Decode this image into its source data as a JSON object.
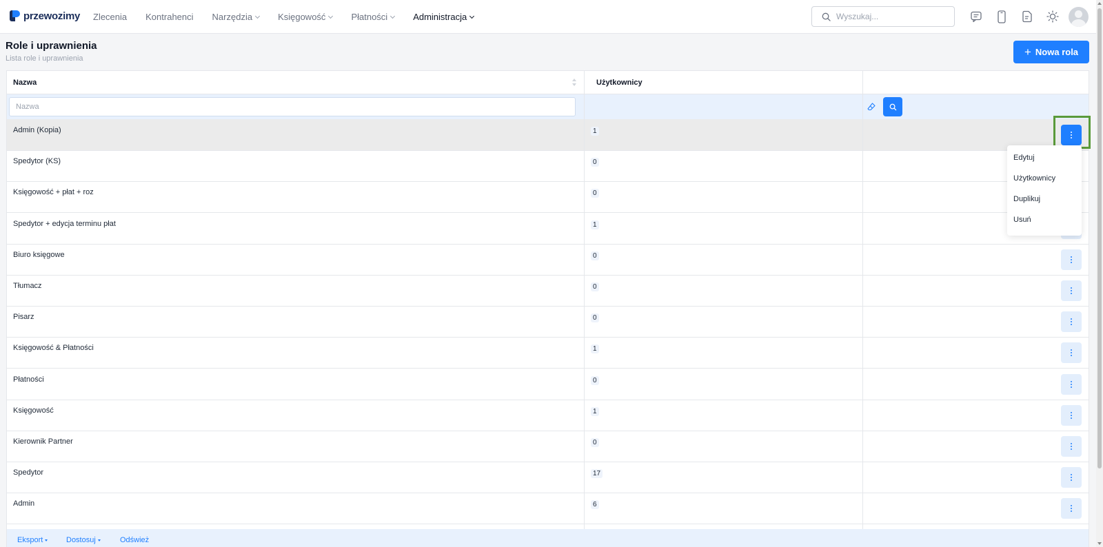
{
  "app": {
    "logo_text": "przewozimy"
  },
  "nav": [
    {
      "label": "Zlecenia",
      "dropdown": false,
      "active": false
    },
    {
      "label": "Kontrahenci",
      "dropdown": false,
      "active": false
    },
    {
      "label": "Narzędzia",
      "dropdown": true,
      "active": false
    },
    {
      "label": "Księgowość",
      "dropdown": true,
      "active": false
    },
    {
      "label": "Płatności",
      "dropdown": true,
      "active": false
    },
    {
      "label": "Administracja",
      "dropdown": true,
      "active": true
    }
  ],
  "search": {
    "placeholder": "Wyszukaj..."
  },
  "header_icons": [
    "chat-icon",
    "phone-icon",
    "document-icon",
    "sun-icon"
  ],
  "page": {
    "title": "Role i uprawnienia",
    "subtitle": "Lista role i uprawnienia",
    "new_button": "Nowa rola"
  },
  "table": {
    "columns": {
      "name": "Nazwa",
      "users": "Użytkownicy"
    },
    "filter_placeholder": "Nazwa",
    "rows": [
      {
        "name": "Admin (Kopia)",
        "count": "1"
      },
      {
        "name": "Spedytor (KS)",
        "count": "0"
      },
      {
        "name": "Księgowość + płat + roz",
        "count": "0"
      },
      {
        "name": "Spedytor + edycja terminu płat",
        "count": "1"
      },
      {
        "name": "Biuro księgowe",
        "count": "0"
      },
      {
        "name": "Tłumacz",
        "count": "0"
      },
      {
        "name": "Pisarz",
        "count": "0"
      },
      {
        "name": "Księgowość & Płatności",
        "count": "1"
      },
      {
        "name": "Płatności",
        "count": "0"
      },
      {
        "name": "Księgowość",
        "count": "1"
      },
      {
        "name": "Kierownik Partner",
        "count": "0"
      },
      {
        "name": "Spedytor",
        "count": "17"
      },
      {
        "name": "Admin",
        "count": "6"
      }
    ]
  },
  "context_menu": {
    "items": [
      "Edytuj",
      "Użytkownicy",
      "Duplikuj",
      "Usuń"
    ]
  },
  "footer": {
    "export": "Eksport",
    "customize": "Dostosuj",
    "refresh": "Odśwież"
  },
  "colors": {
    "accent": "#1f7fff",
    "highlight_border": "#5a9a3a",
    "filter_bg": "#e8f1fd"
  }
}
